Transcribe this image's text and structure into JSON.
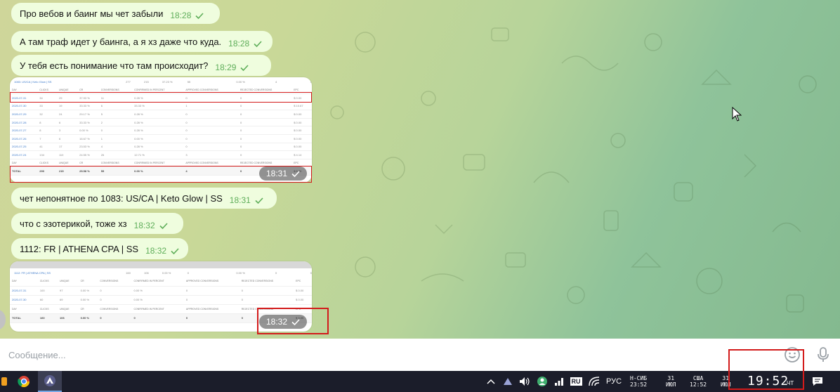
{
  "messages": [
    {
      "text": "Про вебов и баинг мы чет забыли",
      "time": "18:28"
    },
    {
      "text": "А там траф идет у баинга, а я хз даже что куда.",
      "time": "18:28"
    },
    {
      "text": "У тебя есть понимание что там происходит?",
      "time": "18:29"
    },
    {
      "text": "чет непонятное по 1083: US/CA | Keto Glow | SS",
      "time": "18:31"
    },
    {
      "text": "что с эзотерикой, тоже хз",
      "time": "18:32"
    },
    {
      "text": "1112: FR | ATHENA CPA | SS",
      "time": "18:32"
    }
  ],
  "media1": {
    "time": "18:31",
    "title": "1083: US/CA | Keto Glow | SS",
    "summary": [
      "277",
      "215",
      "37.23 %",
      "55",
      "",
      "0.00 %",
      "4",
      "0"
    ],
    "header": [
      "DAY",
      "CLICKS",
      "UNIQUE",
      "CR",
      "CONVERSIONS",
      "CONFIRMED IN PERCENT",
      "APPROVED CONVERSIONS",
      "REJECTED CONVERSIONS",
      "EPC"
    ],
    "rows": [
      [
        "2020-07-31",
        "34",
        "29",
        "37.93 %",
        "11",
        "0.28 %",
        "0",
        "0",
        "$ 0.00"
      ],
      [
        "2020-07-30",
        "33",
        "19",
        "33.33 %",
        "6",
        "33.33 %",
        "1",
        "0",
        "$ 10.67"
      ],
      [
        "2020-07-29",
        "32",
        "24",
        "29.17 %",
        "5",
        "0.28 %",
        "0",
        "0",
        "$ 0.00"
      ],
      [
        "2020-07-28",
        "8",
        "6",
        "33.33 %",
        "2",
        "0.28 %",
        "0",
        "0",
        "$ 0.00"
      ],
      [
        "2020-07-27",
        "8",
        "3",
        "0.00 %",
        "0",
        "0.28 %",
        "0",
        "0",
        "$ 0.00"
      ],
      [
        "2020-07-26",
        "7",
        "6",
        "16.67 %",
        "1",
        "0.00 %",
        "0",
        "0",
        "$ 0.00"
      ],
      [
        "2020-07-25",
        "41",
        "17",
        "23.53 %",
        "4",
        "0.28 %",
        "0",
        "0",
        "$ 0.00"
      ],
      [
        "2020-07-24",
        "134",
        "110",
        "24.55 %",
        "26",
        "12.71 %",
        "3",
        "0",
        "$ 4.14"
      ]
    ],
    "total": [
      "TOTAL",
      "290",
      "215",
      "25.58 %",
      "55",
      "0.00 %",
      "4",
      "0",
      "$ 0.00"
    ]
  },
  "media2": {
    "time": "18:32",
    "title": "1112: FR | ATHENA CPA | SS",
    "summary": [
      "160",
      "106",
      "0.00 %",
      "0",
      "",
      "0.00 %",
      "0",
      "0"
    ],
    "header": [
      "DAY",
      "CLICKS",
      "UNIQUE",
      "CR",
      "CONVERSIONS",
      "CONFIRMED IN PERCENT",
      "APPROVED CONVERSIONS",
      "REJECTED CONVERSIONS",
      "EPC"
    ],
    "rows": [
      [
        "2020-07-31",
        "100",
        "97",
        "0.00 %",
        "0",
        "0.00 %",
        "0",
        "0",
        "$ 0.00"
      ],
      [
        "2020-07-30",
        "60",
        "69",
        "0.00 %",
        "0",
        "0.00 %",
        "0",
        "0",
        "$ 0.00"
      ]
    ],
    "total": [
      "TOTAL",
      "160",
      "106",
      "0.00 %",
      "0",
      "0",
      "0",
      "0",
      "$ 0.00"
    ]
  },
  "composer": {
    "placeholder": "Сообщение..."
  },
  "taskbar": {
    "lang": "RU",
    "keyboard": "РУС",
    "clock1_label": "Н-СИБ",
    "clock1_time": "23:52",
    "date1_day": "31",
    "date1_month": "ИЮЛ",
    "clock2_label": "США",
    "clock2_time": "12:52",
    "date2_day": "31",
    "date2_month": "ИЮЛ",
    "main_time": "19:52",
    "main_day": "ЧТ"
  },
  "colors": {
    "bubble": "#effdde",
    "time": "#5fae5a",
    "highlight": "#d31b1b",
    "taskbar": "#1b1d2a"
  }
}
